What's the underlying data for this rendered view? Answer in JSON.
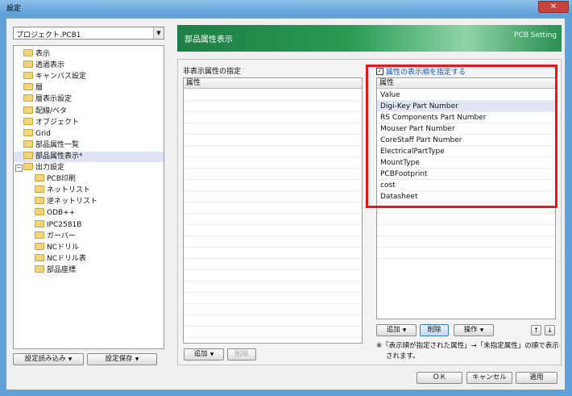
{
  "window": {
    "title": "設定",
    "close": "✕"
  },
  "project_combo": {
    "value": "プロジェクト.PCB1",
    "arrow": "▼"
  },
  "tree": {
    "items": [
      {
        "label": "表示",
        "level": 1
      },
      {
        "label": "透過表示",
        "level": 1
      },
      {
        "label": "キャンバス設定",
        "level": 1
      },
      {
        "label": "層",
        "level": 1
      },
      {
        "label": "層表示設定",
        "level": 1
      },
      {
        "label": "配線/ベタ",
        "level": 1
      },
      {
        "label": "オブジェクト",
        "level": 1
      },
      {
        "label": "Grid",
        "level": 1
      },
      {
        "label": "部品属性一覧",
        "level": 1
      },
      {
        "label": "部品属性表示*",
        "level": 1,
        "selected": true
      },
      {
        "label": "出力設定",
        "level": 1,
        "expander": "⊟"
      },
      {
        "label": "PCB印刷",
        "level": 2
      },
      {
        "label": "ネットリスト",
        "level": 2
      },
      {
        "label": "逆ネットリスト",
        "level": 2
      },
      {
        "label": "ODB++",
        "level": 2
      },
      {
        "label": "IPC2581B",
        "level": 2
      },
      {
        "label": "ガーバー",
        "level": 2
      },
      {
        "label": "NCドリル",
        "level": 2
      },
      {
        "label": "NCドリル表",
        "level": 2
      },
      {
        "label": "部品座標",
        "level": 2
      }
    ]
  },
  "left_buttons": {
    "load": "設定読み込み",
    "save": "設定保存"
  },
  "header": {
    "title": "部品属性表示",
    "subtitle": "PCB Setting"
  },
  "hidden_attrs": {
    "label": "非表示属性の指定",
    "column": "属性",
    "add": "追加",
    "delete": "削除"
  },
  "display_order": {
    "checkbox_label": "属性の表示順を指定する",
    "checked": true,
    "column": "属性",
    "rows": [
      {
        "value": "Value"
      },
      {
        "value": "Digi-Key Part Number",
        "selected": true
      },
      {
        "value": "RS Components Part Number"
      },
      {
        "value": "Mouser Part Number"
      },
      {
        "value": "CoreStaff Part Number"
      },
      {
        "value": "ElectricalPartType"
      },
      {
        "value": "MountType"
      },
      {
        "value": "PCBFootprint"
      },
      {
        "value": "cost"
      },
      {
        "value": "Datasheet"
      }
    ],
    "add": "追加",
    "delete": "削除",
    "operation": "操作",
    "up": "↑",
    "down": "↓",
    "note_line1": "※「表示順が指定された属性」→「未指定属性」の順で表示",
    "note_line2": "されます。"
  },
  "footer": {
    "ok": "ＯＫ",
    "cancel": "キャンセル",
    "apply": "適用"
  },
  "colors": {
    "highlight_border": "#e8161b",
    "header_green": "#2a9a55",
    "title_blue": "#5d9fd6"
  }
}
